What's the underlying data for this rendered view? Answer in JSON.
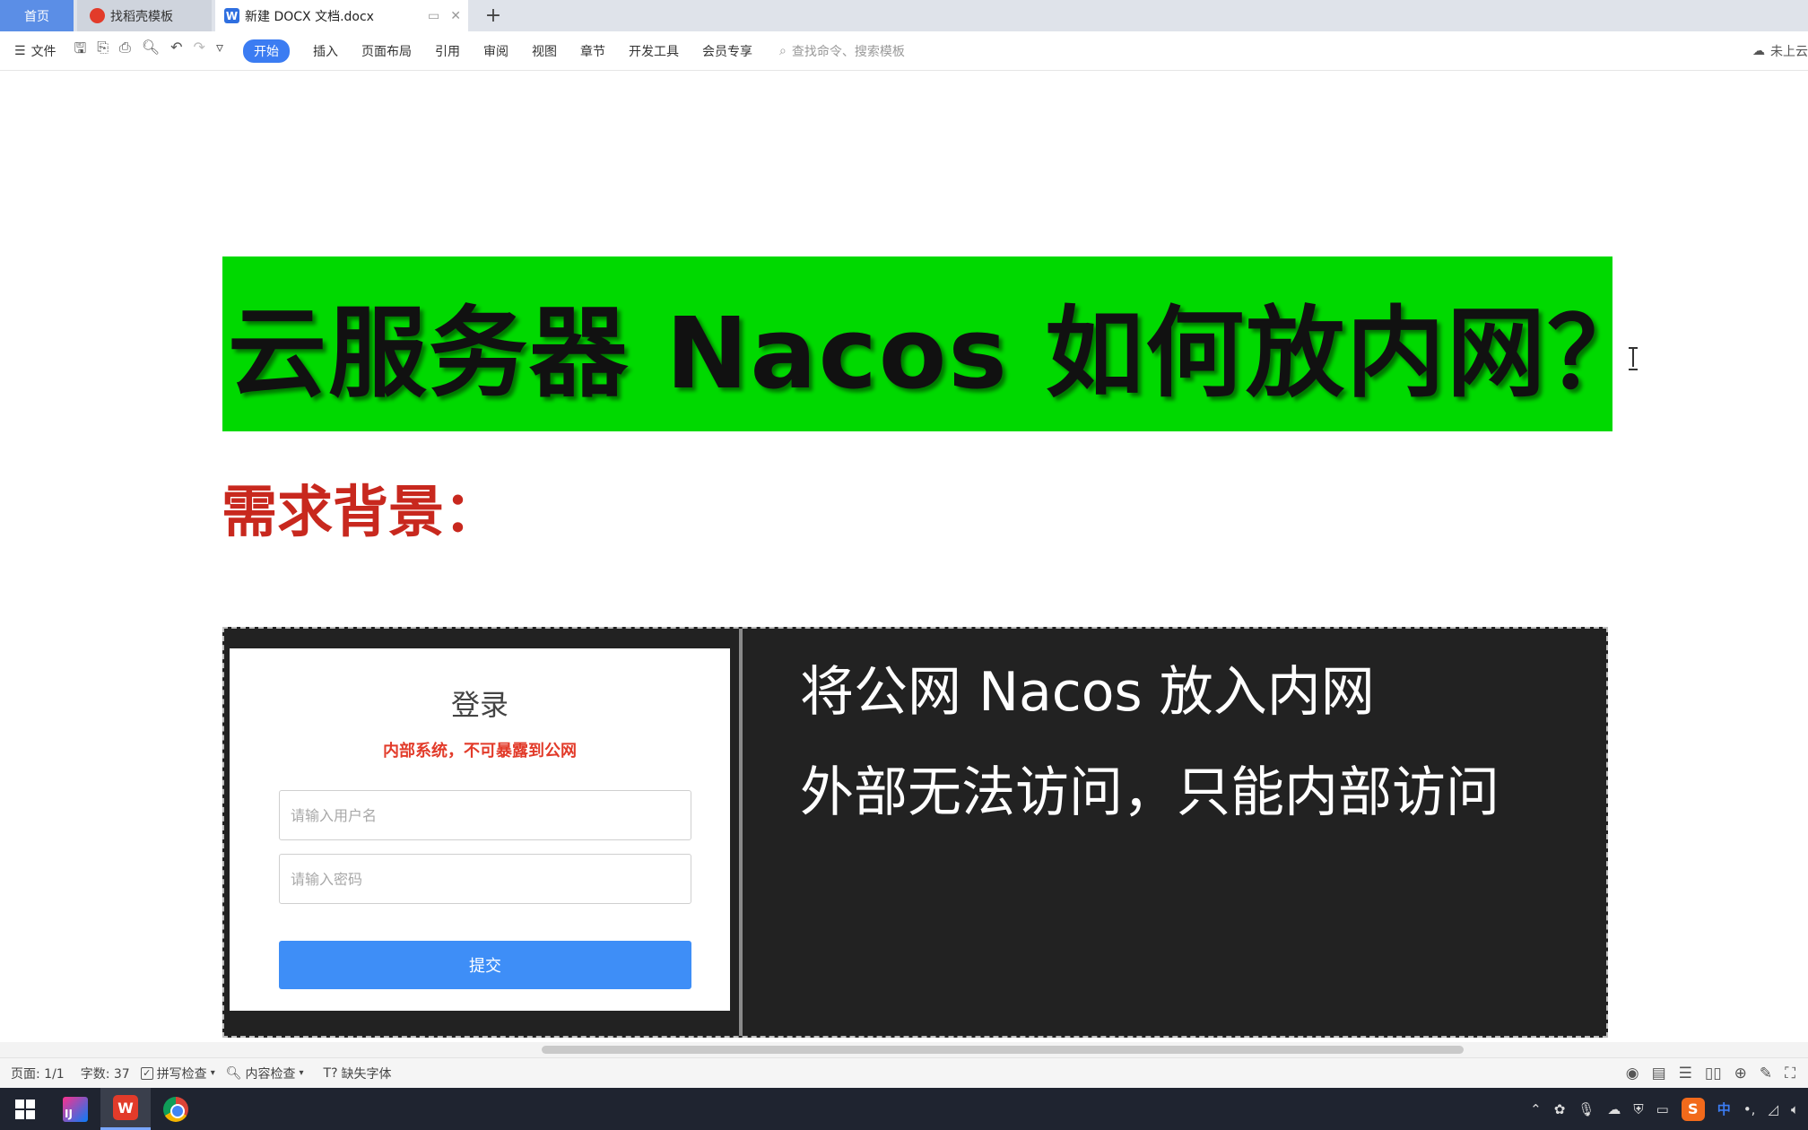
{
  "tabs": {
    "home_label": "首页",
    "template_label": "找稻壳模板",
    "document_label": "新建 DOCX 文档.docx",
    "add_label": "+"
  },
  "toolbar": {
    "file_label": "文件",
    "ribbon_tabs": [
      "开始",
      "插入",
      "页面布局",
      "引用",
      "审阅",
      "视图",
      "章节",
      "开发工具",
      "会员专享"
    ],
    "search_placeholder": "查找命令、搜索模板",
    "cloud_status": "未上云"
  },
  "document": {
    "title": "云服务器 Nacos 如何放内网？",
    "section_heading": "需求背景：",
    "figure": {
      "login_title": "登录",
      "login_warning": "内部系统，不可暴露到公网",
      "username_placeholder": "请输入用户名",
      "password_placeholder": "请输入密码",
      "submit_label": "提交",
      "note_line1": "将公网 Nacos 放入内网",
      "note_line2": "外部无法访问，只能内部访问"
    }
  },
  "statusbar": {
    "page_info": "页面: 1/1",
    "word_count": "字数: 37",
    "spell_check": "拼写检查",
    "content_check": "内容检查",
    "missing_fonts": "缺失字体"
  },
  "taskbar": {
    "ime_label": "中",
    "idea_label": "IJ",
    "wps_label": "W",
    "sogou_label": "S"
  },
  "colors": {
    "title_banner": "#00d900",
    "heading_red": "#c8281e",
    "figure_bg": "#222222",
    "submit_blue": "#3e8ef7",
    "accent_blue": "#3b7cf2"
  }
}
